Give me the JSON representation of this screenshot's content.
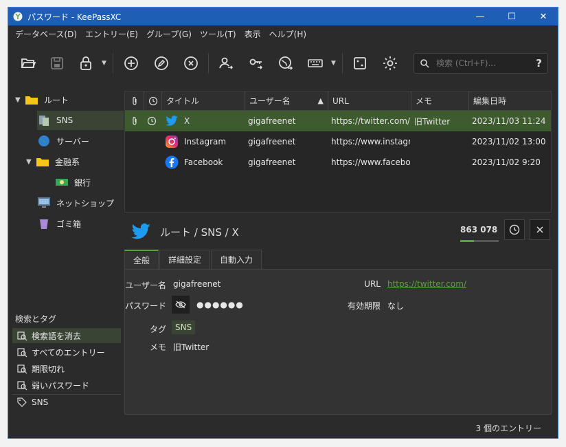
{
  "window": {
    "title": "パスワード - KeePassXC",
    "controls": {
      "minimize": "—",
      "maximize": "☐",
      "close": "✕"
    }
  },
  "menu": [
    "データベース(D)",
    "エントリー(E)",
    "グループ(G)",
    "ツール(T)",
    "表示",
    "ヘルプ(H)"
  ],
  "toolbar": {
    "icons": [
      "open-database-icon",
      "save-database-icon",
      "lock-database-icon",
      "add-entry-icon",
      "edit-entry-icon",
      "delete-entry-icon",
      "copy-username-icon",
      "copy-password-icon",
      "open-url-icon",
      "autotype-icon",
      "password-generator-icon",
      "settings-icon"
    ],
    "search_placeholder": "検索 (Ctrl+F)...",
    "search_help": "?"
  },
  "tree": [
    {
      "label": "ルート",
      "icon": "folder-icon",
      "expanded": true
    },
    {
      "label": "SNS",
      "icon": "sns-group-icon",
      "selected": true
    },
    {
      "label": "サーバー",
      "icon": "globe-icon"
    },
    {
      "label": "金融系",
      "icon": "folder-icon",
      "expanded": true
    },
    {
      "label": "銀行",
      "icon": "banknote-icon"
    },
    {
      "label": "ネットショップ",
      "icon": "monitor-icon"
    },
    {
      "label": "ゴミ箱",
      "icon": "trash-icon"
    }
  ],
  "tags": {
    "header": "検索とタグ",
    "items": [
      {
        "label": "検索語を消去",
        "selected": true
      },
      {
        "label": "すべてのエントリー"
      },
      {
        "label": "期限切れ"
      },
      {
        "label": "弱いパスワード"
      },
      {
        "label": "SNS"
      }
    ]
  },
  "table": {
    "headers": [
      "",
      "",
      "タイトル",
      "ユーザー名",
      "URL",
      "メモ",
      "編集日時"
    ],
    "sort_indicator": "▲",
    "rows": [
      {
        "title": "X",
        "icon": "twitter-icon",
        "username": "gigafreenet",
        "url": "https://twitter.com/",
        "notes": "旧Twitter",
        "modified": "2023/11/03 11:24",
        "selected": true
      },
      {
        "title": "Instagram",
        "icon": "instagram-icon",
        "username": "gigafreenet",
        "url": "https://www.instagr...",
        "notes": "",
        "modified": "2023/11/02 13:00"
      },
      {
        "title": "Facebook",
        "icon": "facebook-icon",
        "username": "gigafreenet",
        "url": "https://www.facebo...",
        "notes": "",
        "modified": "2023/11/02 9:20"
      }
    ]
  },
  "detail": {
    "breadcrumb": "ルート / SNS / X",
    "strength": "863 078",
    "strength_fraction": 0.35,
    "tabs": [
      "全般",
      "詳細設定",
      "自動入力"
    ],
    "fields": {
      "username_label": "ユーザー名",
      "username": "gigafreenet",
      "password_label": "パスワード",
      "password": "●●●●●●",
      "tags_label": "タグ",
      "tag": "SNS",
      "notes_label": "メモ",
      "notes": "旧Twitter",
      "url_label": "URL",
      "url": "https://twitter.com/",
      "expiry_label": "有効期限",
      "expiry": "なし"
    }
  },
  "status": "3 個のエントリー",
  "colors": {
    "accent": "#5aa13b",
    "title_bar": "#1e5fb5",
    "selection": "#3d5b2e"
  }
}
